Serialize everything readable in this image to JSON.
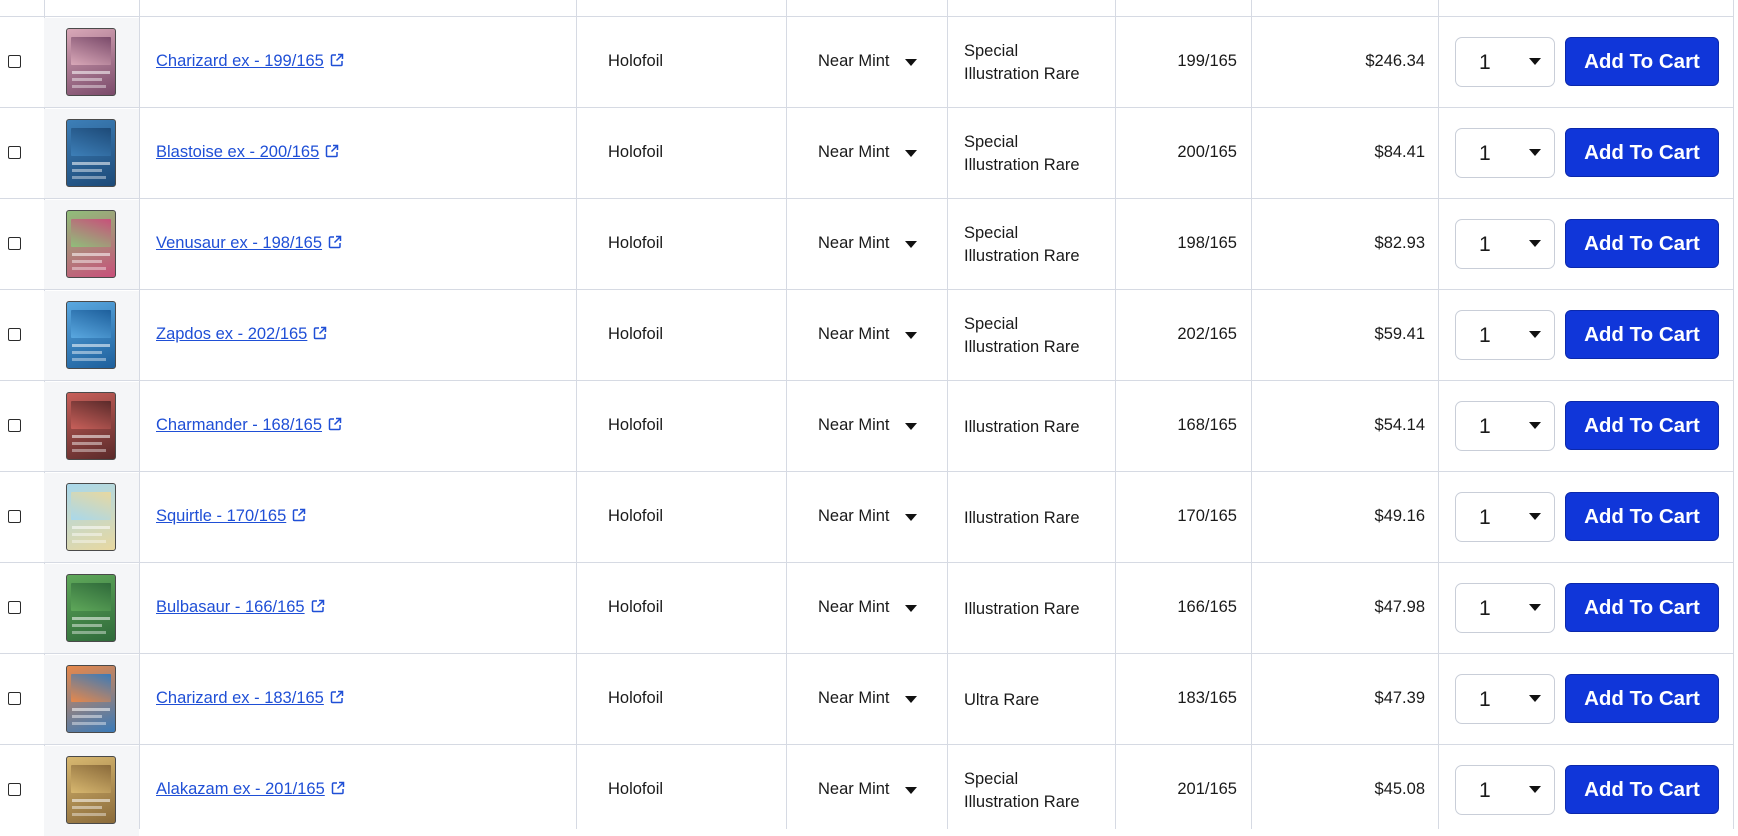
{
  "theme": {
    "link": "#1f4fd6",
    "button": "#1036d9",
    "border": "#d6dae3"
  },
  "icons": {
    "external": "external-link-icon",
    "caret": "caret-down-icon"
  },
  "rows": [
    {
      "name": "Charizard ex - 199/165",
      "printing": "Holofoil",
      "condition": "Near Mint",
      "rarity_lines": [
        "Special",
        "Illustration Rare"
      ],
      "number": "199/165",
      "price": "$246.34",
      "qty": "1",
      "button": "Add To Cart",
      "thumb_colors": [
        "#d9a8b8",
        "#7a4a6a"
      ]
    },
    {
      "name": "Blastoise ex - 200/165",
      "printing": "Holofoil",
      "condition": "Near Mint",
      "rarity_lines": [
        "Special",
        "Illustration Rare"
      ],
      "number": "200/165",
      "price": "$84.41",
      "qty": "1",
      "button": "Add To Cart",
      "thumb_colors": [
        "#3d7fb8",
        "#1d4a78"
      ]
    },
    {
      "name": "Venusaur ex - 198/165",
      "printing": "Holofoil",
      "condition": "Near Mint",
      "rarity_lines": [
        "Special",
        "Illustration Rare"
      ],
      "number": "198/165",
      "price": "$82.93",
      "qty": "1",
      "button": "Add To Cart",
      "thumb_colors": [
        "#8fbf7a",
        "#c8507a"
      ]
    },
    {
      "name": "Zapdos ex - 202/165",
      "printing": "Holofoil",
      "condition": "Near Mint",
      "rarity_lines": [
        "Special",
        "Illustration Rare"
      ],
      "number": "202/165",
      "price": "$59.41",
      "qty": "1",
      "button": "Add To Cart",
      "thumb_colors": [
        "#5aa8e0",
        "#1d5f9c"
      ]
    },
    {
      "name": "Charmander - 168/165",
      "printing": "Holofoil",
      "condition": "Near Mint",
      "rarity_lines": [
        "Illustration Rare"
      ],
      "number": "168/165",
      "price": "$54.14",
      "qty": "1",
      "button": "Add To Cart",
      "thumb_colors": [
        "#c8605a",
        "#5a2a2a"
      ]
    },
    {
      "name": "Squirtle - 170/165",
      "printing": "Holofoil",
      "condition": "Near Mint",
      "rarity_lines": [
        "Illustration Rare"
      ],
      "number": "170/165",
      "price": "$49.16",
      "qty": "1",
      "button": "Add To Cart",
      "thumb_colors": [
        "#a8d8ec",
        "#e8d8a0"
      ]
    },
    {
      "name": "Bulbasaur - 166/165",
      "printing": "Holofoil",
      "condition": "Near Mint",
      "rarity_lines": [
        "Illustration Rare"
      ],
      "number": "166/165",
      "price": "$47.98",
      "qty": "1",
      "button": "Add To Cart",
      "thumb_colors": [
        "#5fa85a",
        "#2f6a3a"
      ]
    },
    {
      "name": "Charizard ex - 183/165",
      "printing": "Holofoil",
      "condition": "Near Mint",
      "rarity_lines": [
        "Ultra Rare"
      ],
      "number": "183/165",
      "price": "$47.39",
      "qty": "1",
      "button": "Add To Cart",
      "thumb_colors": [
        "#e8884a",
        "#3a7ab8"
      ]
    },
    {
      "name": "Alakazam ex - 201/165",
      "printing": "Holofoil",
      "condition": "Near Mint",
      "rarity_lines": [
        "Special",
        "Illustration Rare"
      ],
      "number": "201/165",
      "price": "$45.08",
      "qty": "1",
      "button": "Add To Cart",
      "thumb_colors": [
        "#d8b870",
        "#8a6a3a"
      ]
    }
  ]
}
